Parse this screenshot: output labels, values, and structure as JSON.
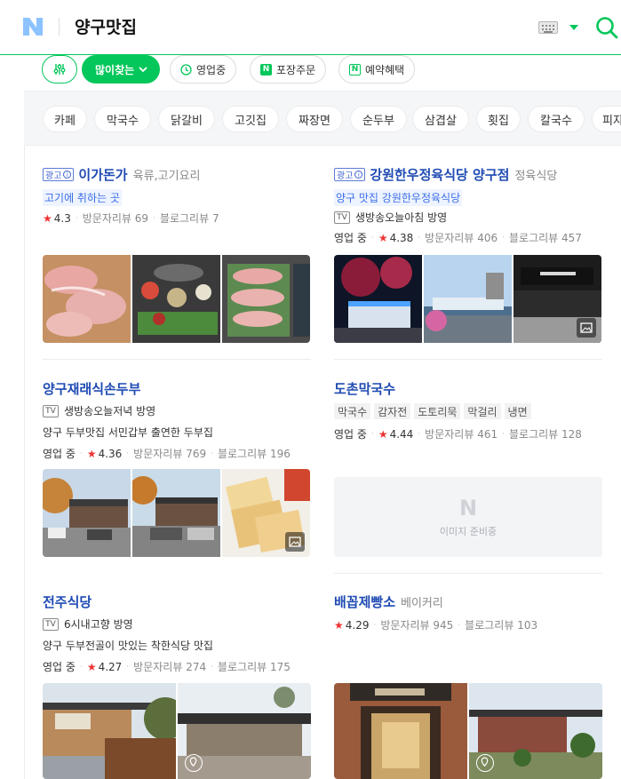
{
  "header": {
    "logo": "N",
    "query": "양구맛집",
    "icons": [
      "keyboard-icon",
      "dropdown-caret-icon",
      "search-icon"
    ]
  },
  "filters": {
    "more_sort": "많이찾는",
    "open_now": "영업중",
    "takeout": "포장주문",
    "reservation": "예약혜택"
  },
  "categories": [
    "카페",
    "막국수",
    "닭갈비",
    "고깃집",
    "짜장면",
    "순두부",
    "삼겹살",
    "횟집",
    "칼국수",
    "피자"
  ],
  "results": [
    {
      "ad_label": "광고",
      "name": "이가돈가",
      "category": "육류,고기요리",
      "promo": "고기에 취하는 곳",
      "rating": "4.3",
      "visitor_label": "방문자리뷰",
      "visitor_reviews": "69",
      "blog_label": "블로그리뷰",
      "blog_reviews": "7"
    },
    {
      "ad_label": "광고",
      "name": "강원한우정육식당 양구점",
      "category": "정육식당",
      "promo": "양구 맛집 강원한우정육식당",
      "tv": "TV",
      "tv_text": "생방송오늘아침 방영",
      "status": "영업 중",
      "rating": "4.38",
      "visitor_label": "방문자리뷰",
      "visitor_reviews": "406",
      "blog_label": "블로그리뷰",
      "blog_reviews": "457"
    },
    {
      "name": "양구재래식손두부",
      "tv": "TV",
      "tv_text": "생방송오늘저녁 방영",
      "description": "양구 두부맛집 서민갑부 출연한 두부집",
      "status": "영업 중",
      "rating": "4.36",
      "visitor_label": "방문자리뷰",
      "visitor_reviews": "769",
      "blog_label": "블로그리뷰",
      "blog_reviews": "196"
    },
    {
      "name": "도촌막국수",
      "tags": [
        "막국수",
        "감자전",
        "도토리묵",
        "막걸리",
        "냉면"
      ],
      "status": "영업 중",
      "rating": "4.44",
      "visitor_label": "방문자리뷰",
      "visitor_reviews": "461",
      "blog_label": "블로그리뷰",
      "blog_reviews": "128",
      "image_placeholder": "이미지 준비중"
    },
    {
      "name": "전주식당",
      "tv": "TV",
      "tv_text": "6시내고향 방영",
      "description": "양구 두부전골이 맛있는 착한식당 맛집",
      "status": "영업 중",
      "rating": "4.27",
      "visitor_label": "방문자리뷰",
      "visitor_reviews": "274",
      "blog_label": "블로그리뷰",
      "blog_reviews": "175"
    },
    {
      "name": "배꼽제빵소",
      "category": "베이커리",
      "rating": "4.29",
      "visitor_label": "방문자리뷰",
      "visitor_reviews": "945",
      "blog_label": "블로그리뷰",
      "blog_reviews": "103"
    }
  ],
  "colors": {
    "brand_green": "#03c75a",
    "title_blue": "#1f4bb3",
    "star_red": "#e33333"
  }
}
